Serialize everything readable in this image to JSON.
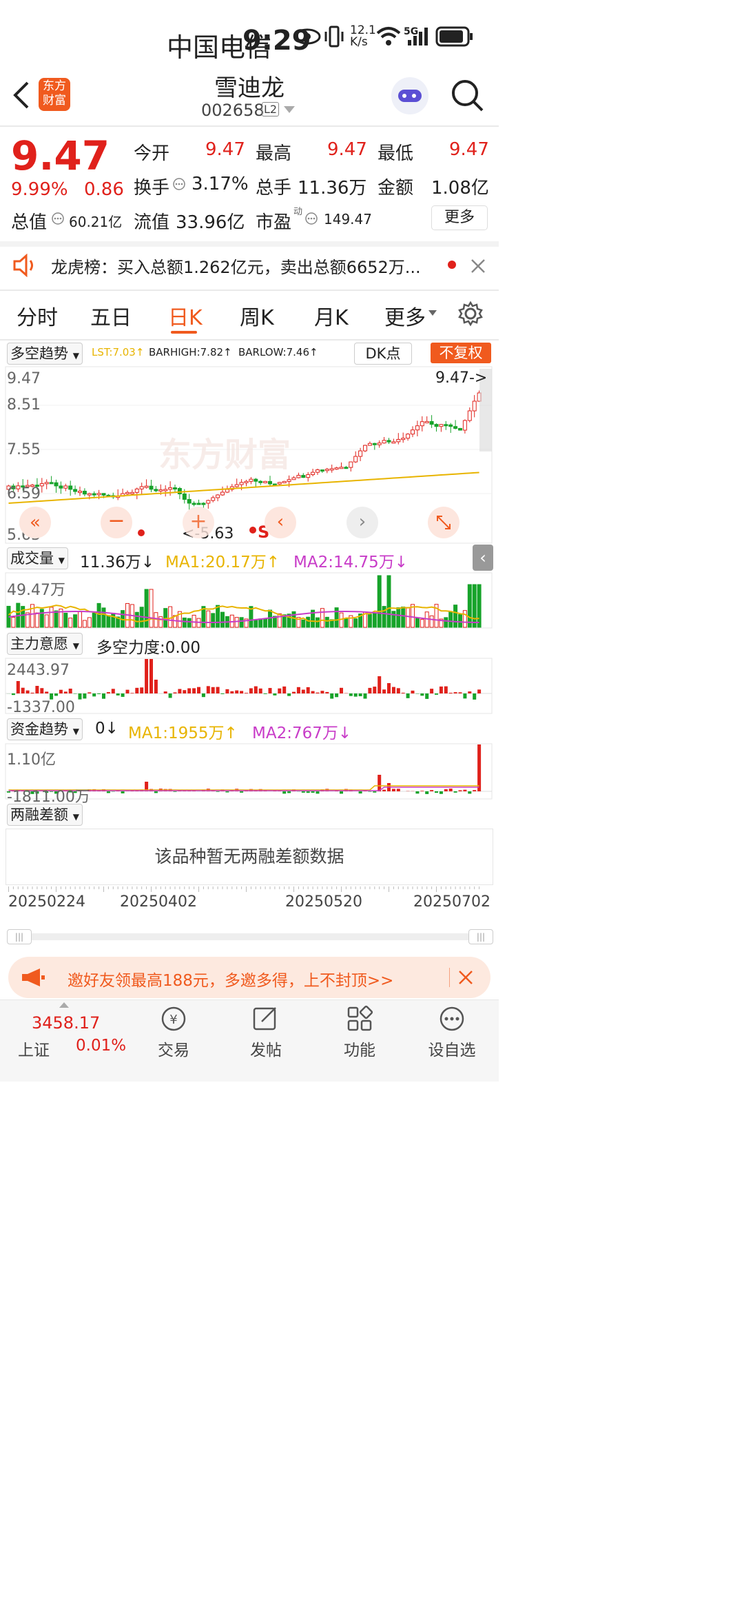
{
  "status_bar": {
    "carrier": "中国电信",
    "time": "9:29",
    "net_speed_top": "12.1",
    "net_speed_bottom": "K/s",
    "network": "5G"
  },
  "header": {
    "back_icon": "chevron-left-icon",
    "logo_line1": "东方",
    "logo_line2": "财富",
    "stock_name": "雪迪龙",
    "stock_code": "002658",
    "level_badge": "L2",
    "search_icon": "search-icon"
  },
  "quote": {
    "price": "9.47",
    "change_pct": "9.99%",
    "change_amt": "0.86",
    "open_label": "今开",
    "open": "9.47",
    "high_label": "最高",
    "high": "9.47",
    "low_label": "最低",
    "low": "9.47",
    "turnover_label": "换手",
    "turnover": "3.17%",
    "volume_label": "总手",
    "volume": "11.36万",
    "amount_label": "金额",
    "amount": "1.08亿",
    "mcap_label": "总值",
    "mcap": "60.21亿",
    "float_label": "流值",
    "float_cap": "33.96亿",
    "pe_label": "市盈",
    "pe_sup": "动",
    "pe": "149.47",
    "more_button": "更多"
  },
  "notice": {
    "text": "龙虎榜：买入总额1.262亿元，卖出总额6652万...",
    "close_icon": "close-icon"
  },
  "tabs": [
    "分时",
    "五日",
    "日K",
    "周K",
    "月K",
    "更多"
  ],
  "active_tab": "日K",
  "kline": {
    "indicator": "多空趋势",
    "lst": "LST:7.03↑",
    "barhigh": "BARHIGH:7.82↑",
    "barlow": "BARLOW:7.46↑",
    "dk_button": "DK点",
    "adjust_button": "不复权",
    "y_labels": [
      "9.47",
      "8.51",
      "7.55",
      "6.59",
      "5.63"
    ],
    "high_marker": "9.47->",
    "low_marker": "<-5.63",
    "sell_marker": "S",
    "watermark": "东方财富"
  },
  "volume_panel": {
    "name": "成交量",
    "current": "11.36万↓",
    "ma1": "MA1:20.17万↑",
    "ma2": "MA2:14.75万↓",
    "max_label": "49.47万"
  },
  "force_panel": {
    "name": "主力意愿",
    "label": "多空力度:0.00",
    "max_label": "2443.97",
    "min_label": "-1337.00"
  },
  "fund_panel": {
    "name": "资金趋势",
    "current": "0↓",
    "ma1": "MA1:1955万↑",
    "ma2": "MA2:767万↓",
    "max_label": "1.10亿",
    "min_label": "-1811.00万"
  },
  "margin_panel": {
    "name": "两融差额",
    "empty_text": "该品种暂无两融差额数据"
  },
  "x_axis": [
    "20250224",
    "20250402",
    "20250520",
    "20250702"
  ],
  "promo": {
    "text": "邀好友领最高188元，多邀多得，上不封顶>>"
  },
  "bottom_nav": {
    "index_value": "3458.17",
    "index_name": "上证",
    "index_change": "0.01%",
    "items": [
      "交易",
      "发帖",
      "功能",
      "设自选"
    ]
  },
  "colors": {
    "up": "#e0211b",
    "down": "#17a32a",
    "accent": "#f05a1e",
    "ma1": "#e8b400",
    "ma2": "#c83cc8"
  }
}
